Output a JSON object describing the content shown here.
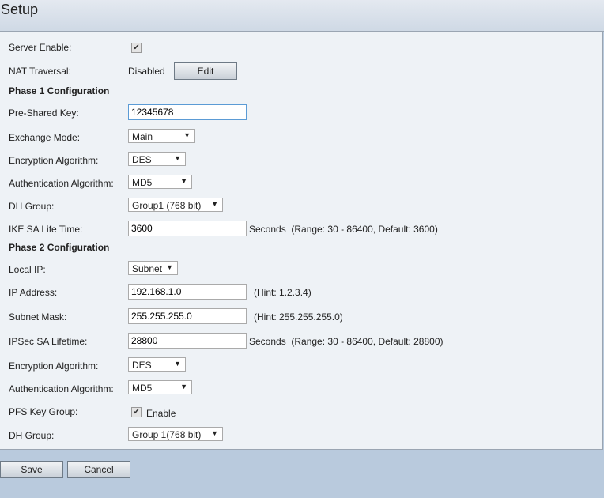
{
  "title": "Setup",
  "server_enable": {
    "label": "Server Enable:",
    "checked": true
  },
  "nat": {
    "label": "NAT Traversal:",
    "value": "Disabled",
    "edit": "Edit"
  },
  "phase1": {
    "heading": "Phase 1 Configuration",
    "psk": {
      "label": "Pre-Shared Key:",
      "value": "12345678"
    },
    "exchange": {
      "label": "Exchange Mode:",
      "value": "Main"
    },
    "enc": {
      "label": "Encryption Algorithm:",
      "value": "DES"
    },
    "auth": {
      "label": "Authentication Algorithm:",
      "value": "MD5"
    },
    "dh": {
      "label": "DH Group:",
      "value": "Group1 (768 bit)"
    },
    "ike": {
      "label": "IKE SA Life Time:",
      "value": "3600",
      "hint": "Seconds  (Range: 30 - 86400, Default: 3600)"
    }
  },
  "phase2": {
    "heading": "Phase 2 Configuration",
    "local_ip": {
      "label": "Local IP:",
      "value": "Subnet"
    },
    "ip": {
      "label": "IP Address:",
      "value": "192.168.1.0",
      "hint": "(Hint: 1.2.3.4)"
    },
    "mask": {
      "label": "Subnet Mask:",
      "value": "255.255.255.0",
      "hint": "(Hint: 255.255.255.0)"
    },
    "ipsec": {
      "label": "IPSec SA Lifetime:",
      "value": "28800",
      "hint": "Seconds  (Range: 30 - 86400, Default: 28800)"
    },
    "enc": {
      "label": "Encryption Algorithm:",
      "value": "DES"
    },
    "auth": {
      "label": "Authentication Algorithm:",
      "value": "MD5"
    },
    "pfs": {
      "label": "PFS Key Group:",
      "checkbox_label": "Enable",
      "checked": true
    },
    "dh": {
      "label": "DH Group:",
      "value": "Group 1(768 bit)"
    }
  },
  "buttons": {
    "save": "Save",
    "cancel": "Cancel"
  }
}
